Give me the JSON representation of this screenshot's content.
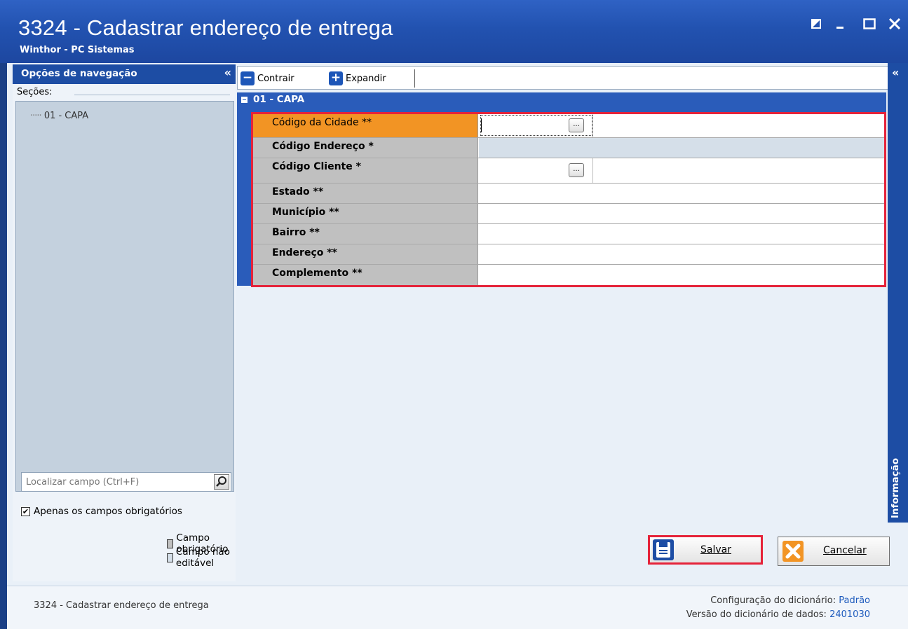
{
  "window": {
    "title": "3324 - Cadastrar endereço de entrega",
    "subtitle": "Winthor - PC Sistemas",
    "controls": [
      "restore-icon",
      "minimize-icon",
      "maximize-icon",
      "close-icon"
    ]
  },
  "nav": {
    "header": "Opções de navegação",
    "collapse_glyph": "«",
    "sections_label": "Seções:",
    "tree_items": [
      "01 - CAPA"
    ],
    "search_placeholder": "Localizar campo (Ctrl+F)",
    "only_required_label": "Apenas os campos obrigatórios",
    "only_required_checked": true
  },
  "legend": {
    "required": "Campo obrigatório",
    "not_editable": "Campo não editável",
    "required_color": "#c0c0c0",
    "not_editable_color": "#d5dfe9"
  },
  "toolbar": {
    "collapse_label": "Contrair",
    "expand_label": "Expandir"
  },
  "section": {
    "title": "01 - CAPA",
    "fields": [
      {
        "label": "Código da Cidade **",
        "value": "",
        "has_lookup": true,
        "editable": true,
        "active": true
      },
      {
        "label": "Código Endereço *",
        "value": "",
        "has_lookup": false,
        "editable": false
      },
      {
        "label": "Código Cliente  *",
        "value": "",
        "has_lookup": true,
        "editable": true
      },
      {
        "label": "Estado **",
        "value": "",
        "has_lookup": false,
        "editable": true
      },
      {
        "label": "Município **",
        "value": "",
        "has_lookup": false,
        "editable": true
      },
      {
        "label": "Bairro **",
        "value": "",
        "has_lookup": false,
        "editable": true
      },
      {
        "label": "Endereço **",
        "value": "",
        "has_lookup": false,
        "editable": true
      },
      {
        "label": "Complemento **",
        "value": "",
        "has_lookup": false,
        "editable": true
      }
    ],
    "lookup_label": "..."
  },
  "info_panel": {
    "label": "Informação",
    "collapse_glyph": "«"
  },
  "actions": {
    "save_label": "Salvar",
    "cancel_label": "Cancelar"
  },
  "footer": {
    "title": "3324 - Cadastrar endereço de entrega",
    "dict_config_label": "Configuração do dicionário:",
    "dict_config_value": "Padrão",
    "dict_version_label": "Versão do dicionário de dados:",
    "dict_version_value": "2401030"
  },
  "colors": {
    "titlebar": "#2252b0",
    "accent_blue": "#1d4da4",
    "highlight_red": "#e5233a",
    "active_field": "#f29424"
  }
}
